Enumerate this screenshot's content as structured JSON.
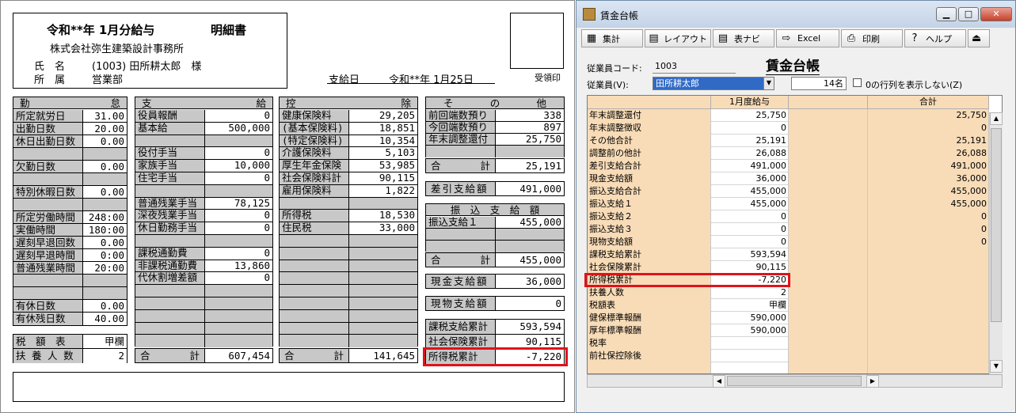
{
  "slip": {
    "title": "令和**年 1月分給与",
    "title_suffix": "明細書",
    "company": "株式会社弥生建築設計事務所",
    "name_label": "氏　名",
    "name_value": "(1003) 田所耕太郎　様",
    "dept_label": "所　属",
    "dept_value": "営業部",
    "payday_label": "支給日",
    "payday_value": "令和**年 1月25日",
    "stamp_label": "受領印",
    "attendance": {
      "header_left": "勤",
      "header_right": "怠",
      "rows": [
        {
          "label": "所定就労日",
          "value": "31.00"
        },
        {
          "label": "出勤日数",
          "value": "20.00"
        },
        {
          "label": "休日出勤日数",
          "value": "0.00"
        },
        {
          "label": "",
          "value": ""
        },
        {
          "label": "欠勤日数",
          "value": "0.00"
        },
        {
          "label": "",
          "value": ""
        },
        {
          "label": "特別休暇日数",
          "value": "0.00"
        },
        {
          "label": "",
          "value": ""
        },
        {
          "label": "所定労働時間",
          "value": "248:00"
        },
        {
          "label": "実働時間",
          "value": "180:00"
        },
        {
          "label": "遅刻早退回数",
          "value": "0.00"
        },
        {
          "label": "遅刻早退時間",
          "value": "0:00"
        },
        {
          "label": "普通残業時間",
          "value": "20:00"
        },
        {
          "label": "",
          "value": ""
        },
        {
          "label": "",
          "value": ""
        },
        {
          "label": "有休日数",
          "value": "0.00"
        },
        {
          "label": "有休残日数",
          "value": "40.00"
        }
      ]
    },
    "tax_table": {
      "label_l": "税　額　表",
      "value_l": "甲欄",
      "label_d": "扶 養 人 数",
      "value_d": "2"
    },
    "payments": {
      "header_left": "支",
      "header_right": "給",
      "rows": [
        {
          "label": "役員報酬",
          "value": "0"
        },
        {
          "label": "基本給",
          "value": "500,000"
        },
        {
          "label": "",
          "value": ""
        },
        {
          "label": "役付手当",
          "value": "0"
        },
        {
          "label": "家族手当",
          "value": "10,000"
        },
        {
          "label": "住宅手当",
          "value": "0"
        },
        {
          "label": "",
          "value": ""
        },
        {
          "label": "普通残業手当",
          "value": "78,125"
        },
        {
          "label": "深夜残業手当",
          "value": "0"
        },
        {
          "label": "休日勤務手当",
          "value": "0"
        },
        {
          "label": "",
          "value": ""
        },
        {
          "label": "課税通勤費",
          "value": "0"
        },
        {
          "label": "非課税通勤費",
          "value": "13,860"
        },
        {
          "label": "代休割増差額",
          "value": "0"
        },
        {
          "label": "",
          "value": ""
        },
        {
          "label": "",
          "value": ""
        },
        {
          "label": "",
          "value": ""
        },
        {
          "label": "",
          "value": ""
        },
        {
          "label": "",
          "value": ""
        }
      ],
      "total_label_l": "合",
      "total_label_r": "計",
      "total_value": "607,454"
    },
    "deductions": {
      "header_left": "控",
      "header_right": "除",
      "rows": [
        {
          "label": "健康保険料",
          "value": "29,205"
        },
        {
          "label": "(基本保険料)",
          "value": "18,851"
        },
        {
          "label": "(特定保険料)",
          "value": "10,354"
        },
        {
          "label": "介護保険料",
          "value": "5,103"
        },
        {
          "label": "厚生年金保険",
          "value": "53,985"
        },
        {
          "label": "社会保険料計",
          "value": "90,115"
        },
        {
          "label": "雇用保険料",
          "value": "1,822"
        },
        {
          "label": "",
          "value": ""
        },
        {
          "label": "所得税",
          "value": "18,530"
        },
        {
          "label": "住民税",
          "value": "33,000"
        },
        {
          "label": "",
          "value": ""
        },
        {
          "label": "",
          "value": ""
        },
        {
          "label": "",
          "value": ""
        },
        {
          "label": "",
          "value": ""
        },
        {
          "label": "",
          "value": ""
        },
        {
          "label": "",
          "value": ""
        },
        {
          "label": "",
          "value": ""
        },
        {
          "label": "",
          "value": ""
        },
        {
          "label": "",
          "value": ""
        }
      ],
      "total_label_l": "合",
      "total_label_r": "計",
      "total_value": "141,645"
    },
    "other": {
      "header_l": "そ",
      "header_m": "の",
      "header_r": "他",
      "rows": [
        {
          "label": "前回端数預り",
          "value": "338"
        },
        {
          "label": "今回端数預り",
          "value": "897"
        },
        {
          "label": "年末調整還付",
          "value": "25,750"
        },
        {
          "label": "",
          "value": ""
        }
      ],
      "total_label_l": "合",
      "total_label_r": "計",
      "total_value": "25,191"
    },
    "net_pay": {
      "label": "差引支給額",
      "value": "491,000"
    },
    "transfer": {
      "header": "振　込　支　給　額",
      "rows": [
        {
          "label": "振込支給１",
          "value": "455,000"
        },
        {
          "label": "",
          "value": ""
        },
        {
          "label": "",
          "value": ""
        }
      ],
      "total_label_l": "合",
      "total_label_r": "計",
      "total_value": "455,000"
    },
    "cash": {
      "label": "現金支給額",
      "value": "36,000"
    },
    "goods": {
      "label": "現物支給額",
      "value": "0"
    },
    "cumulative": [
      {
        "label": "課税支給累計",
        "value": "593,594"
      },
      {
        "label": "社会保険累計",
        "value": "90,115"
      },
      {
        "label": "所得税累計",
        "value": "-7,220"
      }
    ]
  },
  "window": {
    "title": "賃金台帳",
    "controls": {
      "minimize": "▁",
      "maximize": "□",
      "close": "✕"
    },
    "toolbar": [
      {
        "name": "tally",
        "icon": "▦",
        "label": "集計"
      },
      {
        "name": "layout",
        "icon": "▤",
        "label": "レイアウト"
      },
      {
        "name": "table-navi",
        "icon": "▤",
        "label": "表ナビ"
      },
      {
        "name": "excel",
        "icon": "⇨",
        "label": "Excel"
      },
      {
        "name": "print",
        "icon": "⎙",
        "label": "印刷"
      },
      {
        "name": "help",
        "icon": "?",
        "label": "ヘルプ"
      },
      {
        "name": "exit",
        "icon": "⏏",
        "label": ""
      }
    ],
    "employee_code_label": "従業員コード:",
    "employee_code_value": "1003",
    "employee_label": "従業員(V):",
    "employee_value": "田所耕太郎",
    "heading": "賃金台帳",
    "count_value": "14名",
    "hide_zero_label": "0の行列を表示しない(Z)",
    "columns": [
      "1月度給与",
      "",
      "合計"
    ],
    "rows": [
      {
        "label": "年末調整還付",
        "v1": "25,750",
        "total": "25,750"
      },
      {
        "label": "年末調整徴収",
        "v1": "0",
        "total": "0"
      },
      {
        "label": "その他合計",
        "v1": "25,191",
        "total": "25,191"
      },
      {
        "label": "調整前の他計",
        "v1": "26,088",
        "total": "26,088"
      },
      {
        "label": "差引支給合計",
        "v1": "491,000",
        "total": "491,000"
      },
      {
        "label": "現金支給額",
        "v1": "36,000",
        "total": "36,000"
      },
      {
        "label": "振込支給合計",
        "v1": "455,000",
        "total": "455,000"
      },
      {
        "label": "振込支給１",
        "v1": "455,000",
        "total": "455,000"
      },
      {
        "label": "振込支給２",
        "v1": "0",
        "total": "0"
      },
      {
        "label": "振込支給３",
        "v1": "0",
        "total": "0"
      },
      {
        "label": "現物支給額",
        "v1": "0",
        "total": "0"
      },
      {
        "label": "課税支給累計",
        "v1": "593,594",
        "total": ""
      },
      {
        "label": "社会保険累計",
        "v1": "90,115",
        "total": ""
      },
      {
        "label": "所得税累計",
        "v1": "-7,220",
        "total": ""
      },
      {
        "label": "扶養人数",
        "v1": "2",
        "total": ""
      },
      {
        "label": "税額表",
        "v1": "甲欄",
        "total": ""
      },
      {
        "label": "健保標準報酬",
        "v1": "590,000",
        "total": ""
      },
      {
        "label": "厚年標準報酬",
        "v1": "590,000",
        "total": ""
      },
      {
        "label": "税率",
        "v1": "",
        "total": ""
      },
      {
        "label": "前社保控除後",
        "v1": "",
        "total": ""
      },
      {
        "label": "",
        "v1": "",
        "total": ""
      }
    ]
  }
}
